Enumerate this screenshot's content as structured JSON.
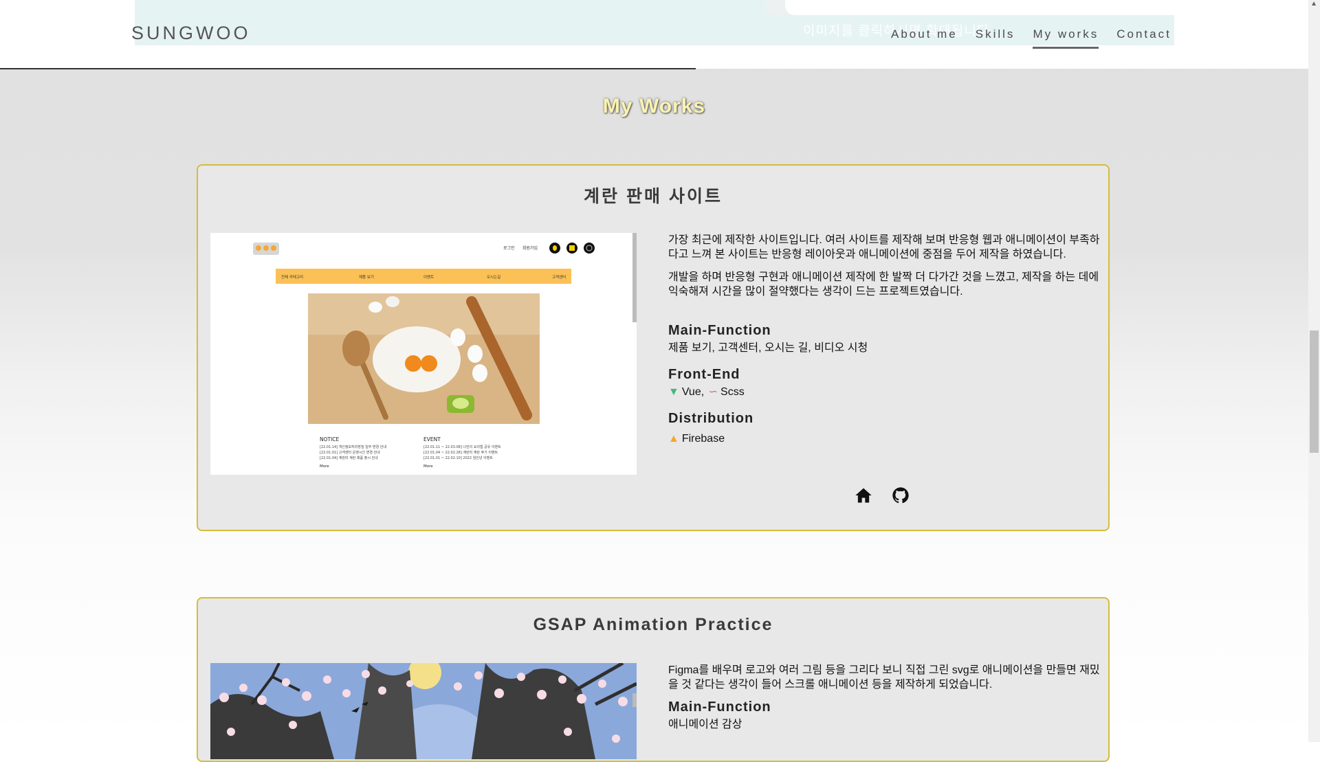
{
  "header": {
    "logo": "SUNGWOO",
    "nav": [
      "About me",
      "Skills",
      "My works",
      "Contact"
    ],
    "active_nav": "My works"
  },
  "prev_section": {
    "caption": "이미지를 클릭하시면 확대됩니다"
  },
  "section_title": "My Works",
  "projects": [
    {
      "title": "계란 판매 사이트",
      "description": [
        "가장 최근에 제작한 사이트입니다. 여러 사이트를 제작해 보며 반응형 웹과 애니메이션이 부족하다고 느껴 본 사이트는 반응형 레이아웃과 애니메이션에 중점을 두어 제작을 하였습니다.",
        "개발을 하며 반응형 구현과 애니메이션 제작에 한 발짝 더 다가간 것을 느꼈고, 제작을 하는 데에 익숙해져 시간을 많이 절약했다는 생각이 드는 프로젝트였습니다."
      ],
      "main_function_label": "Main-Function",
      "main_function": "제품 보기, 고객센터, 오시는 길, 비디오 시청",
      "frontend_label": "Front-End",
      "frontend": [
        "Vue,",
        "Scss"
      ],
      "distribution_label": "Distribution",
      "distribution": "Firebase",
      "screenshot": {
        "login": "로그인",
        "signup": "회원가입",
        "menu": [
          "전체 카테고리",
          "제품 보기",
          "이벤트",
          "오시는길",
          "고객센터"
        ],
        "notice_title": "NOTICE",
        "notice_items": [
          "[22.01.14] 개인정보처리방침 일부 변경 안내",
          "[22.01.01] 고객센터 운영시간 변경 안내",
          "[22.01.04] 계란미 계란 제품 출시 안내"
        ],
        "event_title": "EVENT",
        "event_items": [
          "[22.01.11 ~ 22.03.08] 나만의 요리법 공유 이벤트",
          "[22.01.04 ~ 22.02.28] 계란미 계란 후기 이벤트",
          "[22.01.01 ~ 22.02.10] 2022 임인년 이벤트"
        ],
        "more": "More"
      }
    },
    {
      "title": "GSAP Animation Practice",
      "description": [
        "Figma를 배우며 로고와 여러 그림 등을 그리다 보니 직접 그린 svg로 애니메이션을 만들면 재밌을 것 같다는 생각이 들어 스크롤 애니메이션 등을 제작하게 되었습니다."
      ],
      "main_function_label": "Main-Function",
      "main_function": "애니메이션 감상"
    }
  ],
  "icons": {
    "home": "home-icon",
    "github": "github-icon"
  }
}
